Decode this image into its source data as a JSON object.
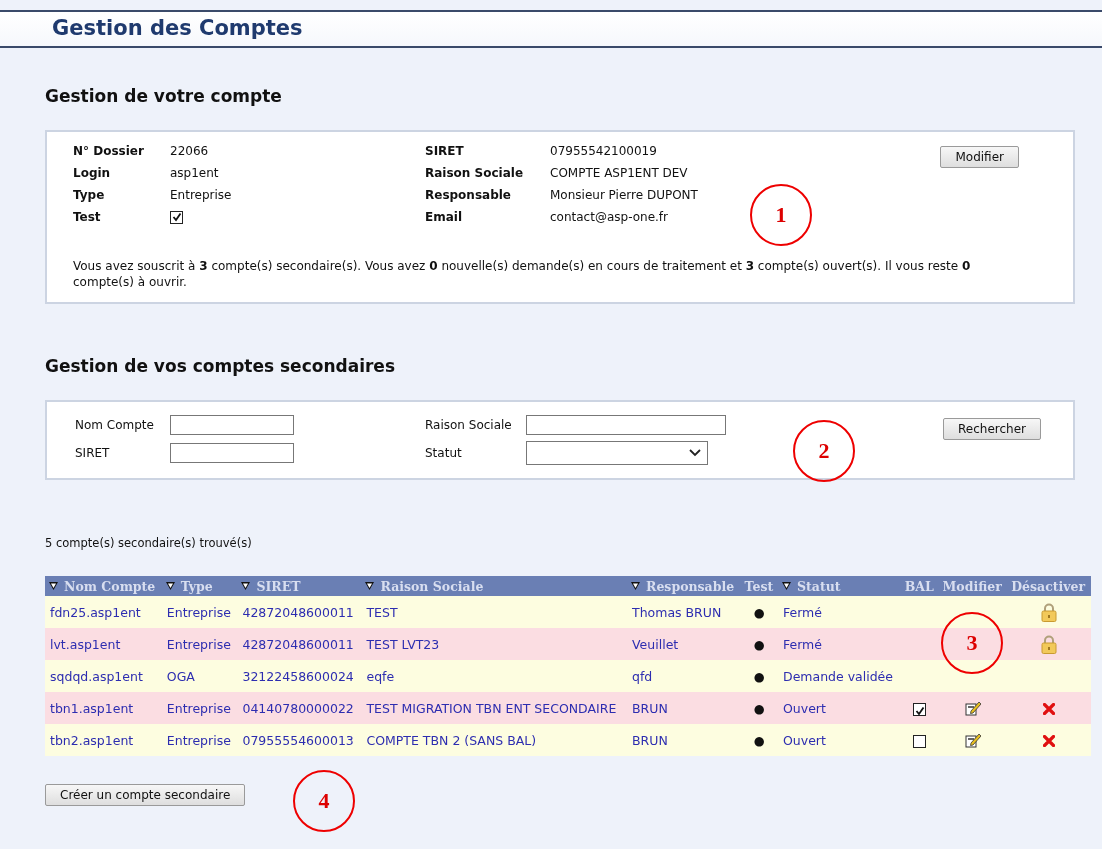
{
  "header": {
    "title": "Gestion des Comptes"
  },
  "account": {
    "title": "Gestion de votre compte",
    "fields": [
      {
        "label": "N° Dossier",
        "value": "22066"
      },
      {
        "label": "SIRET",
        "value": "07955542100019"
      },
      {
        "label": "Login",
        "value": "asp1ent"
      },
      {
        "label": "Raison Sociale",
        "value": "COMPTE ASP1ENT DEV"
      },
      {
        "label": "Type",
        "value": "Entreprise"
      },
      {
        "label": "Responsable",
        "value": "Monsieur Pierre DUPONT"
      },
      {
        "label": "Test",
        "kind": "checkbox",
        "checked": true
      },
      {
        "label": "Email",
        "value": "contact@asp-one.fr"
      }
    ],
    "button": "Modifier",
    "summary": "Vous avez souscrit à **3** compte(s) secondaire(s). Vous avez **0** nouvelle(s) demande(s) en cours de traitement et **3** compte(s) ouvert(s). Il vous reste **0** compte(s) à ouvrir.",
    "callout": "1"
  },
  "secondary": {
    "title": "Gestion de vos comptes secondaires",
    "search": {
      "fields": [
        {
          "label": "Nom Compte",
          "kind": "text"
        },
        {
          "label": "Raison Sociale",
          "kind": "text"
        },
        {
          "label": "SIRET",
          "kind": "text"
        },
        {
          "label": "Statut",
          "kind": "select"
        }
      ],
      "button": "Rechercher",
      "callout": "2"
    },
    "result_count": "5 compte(s) secondaire(s) trouvé(s)",
    "table": {
      "columns": [
        {
          "label": "Nom Compte",
          "sortable": true
        },
        {
          "label": "Type",
          "sortable": true
        },
        {
          "label": "SIRET",
          "sortable": true
        },
        {
          "label": "Raison Sociale",
          "sortable": true
        },
        {
          "label": "Responsable",
          "sortable": true
        },
        {
          "label": "Test",
          "sortable": false
        },
        {
          "label": "Statut",
          "sortable": true
        },
        {
          "label": "BAL",
          "sortable": false
        },
        {
          "label": "Modifier",
          "sortable": false
        },
        {
          "label": "Désactiver",
          "sortable": false
        }
      ],
      "rows": [
        {
          "name": "fdn25.asp1ent",
          "type": "Entreprise",
          "siret": "42872048600011",
          "raison": "TEST",
          "responsable": "Thomas BRUN",
          "test": "●",
          "statut": "Fermé",
          "editable": false,
          "locked": true
        },
        {
          "name": "lvt.asp1ent",
          "type": "Entreprise",
          "siret": "42872048600011",
          "raison": "TEST LVT23",
          "responsable": "Veuillet",
          "test": "●",
          "statut": "Fermé",
          "editable": false,
          "locked": true
        },
        {
          "name": "sqdqd.asp1ent",
          "type": "OGA",
          "siret": "32122458600024",
          "raison": "eqfe",
          "responsable": "qfd",
          "test": "●",
          "statut": "Demande validée",
          "editable": false
        },
        {
          "name": "tbn1.asp1ent",
          "type": "Entreprise",
          "siret": "04140780000022",
          "raison": "TEST MIGRATION TBN ENT SECONDAIRE",
          "responsable": "BRUN",
          "test": "●",
          "statut": "Ouvert",
          "bal": true,
          "editable": true,
          "locked": false
        },
        {
          "name": "tbn2.asp1ent",
          "type": "Entreprise",
          "siret": "07955554600013",
          "raison": "COMPTE TBN 2 (SANS BAL)",
          "responsable": "BRUN",
          "test": "●",
          "statut": "Ouvert",
          "bal": false,
          "editable": true,
          "locked": false
        }
      ],
      "callout": "3"
    },
    "create_button": "Créer un compte secondaire",
    "callout": "4"
  }
}
